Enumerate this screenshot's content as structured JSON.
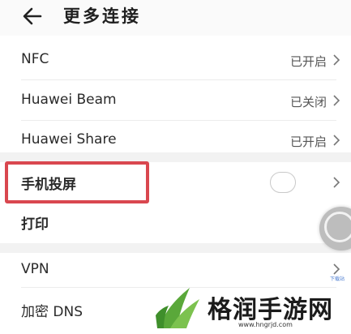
{
  "header": {
    "title": "更多连接"
  },
  "items": [
    {
      "label": "NFC",
      "status": "已开启"
    },
    {
      "label": "Huawei Beam",
      "status": "已关闭"
    },
    {
      "label": "Huawei Share",
      "status": "已开启"
    },
    {
      "label": "手机投屏",
      "status": ""
    },
    {
      "label": "打印",
      "status": ""
    },
    {
      "label": "VPN",
      "status": ""
    },
    {
      "label": "加密 DNS",
      "status": ""
    }
  ],
  "overlay": {
    "tiny_link": "下载站"
  },
  "watermark": {
    "name": "格润手游网",
    "url": "www.hngrjd.com"
  },
  "colors": {
    "highlight": "#d9474f",
    "watermark_green": "#5aa83a"
  }
}
